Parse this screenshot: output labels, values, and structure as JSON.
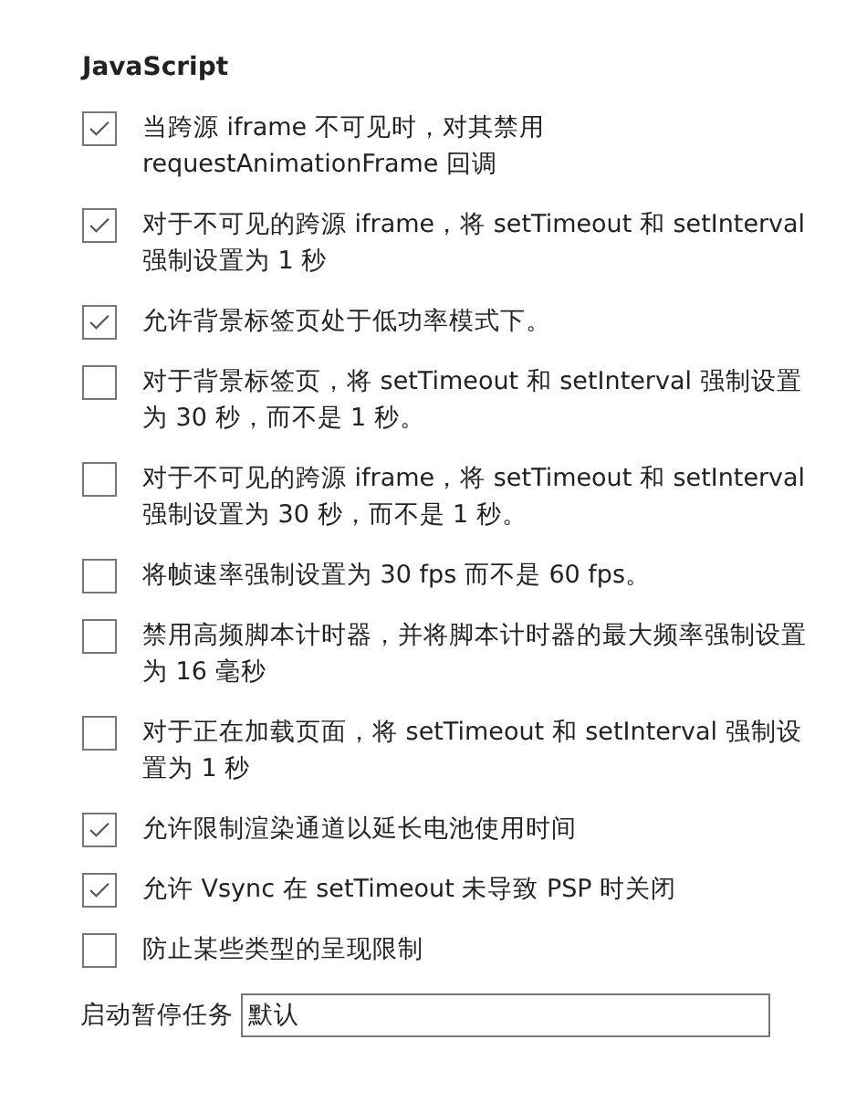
{
  "section_title": "JavaScript",
  "options": [
    {
      "label": "当跨源 iframe 不可见时，对其禁用 requestAnimationFrame 回调",
      "checked": true
    },
    {
      "label": "对于不可见的跨源 iframe，将 setTimeout 和 setInterval 强制设置为 1 秒",
      "checked": true
    },
    {
      "label": "允许背景标签页处于低功率模式下。",
      "checked": true
    },
    {
      "label": "对于背景标签页，将 setTimeout 和 setInterval 强制设置为 30 秒，而不是 1 秒。",
      "checked": false
    },
    {
      "label": "对于不可见的跨源 iframe，将 setTimeout 和 setInterval 强制设置为 30 秒，而不是 1 秒。",
      "checked": false
    },
    {
      "label": "将帧速率强制设置为 30 fps 而不是 60 fps。",
      "checked": false
    },
    {
      "label": "禁用高频脚本计时器，并将脚本计时器的最大频率强制设置为 16 毫秒",
      "checked": false
    },
    {
      "label": "对于正在加载页面，将 setTimeout 和 setInterval 强制设置为 1 秒",
      "checked": false
    },
    {
      "label": "允许限制渲染通道以延长电池使用时间",
      "checked": true
    },
    {
      "label": "允许 Vsync 在 setTimeout 未导致 PSP 时关闭",
      "checked": true
    },
    {
      "label": "防止某些类型的呈现限制",
      "checked": false
    }
  ],
  "suspend_tasks": {
    "label": "启动暂停任务",
    "value": "默认"
  }
}
